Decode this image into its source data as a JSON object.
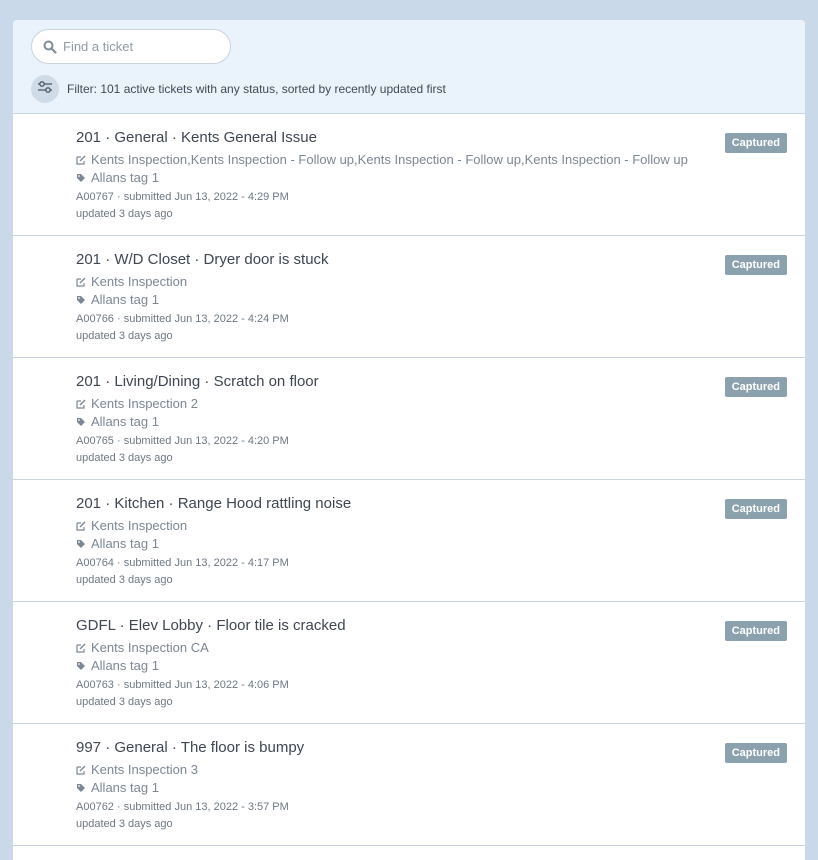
{
  "search": {
    "placeholder": "Find a ticket",
    "icon": "search-icon"
  },
  "filter": {
    "icon": "sliders-icon",
    "text": "Filter: 101 active tickets with any status, sorted by recently updated first"
  },
  "tickets": [
    {
      "title": "201 · General · Kents General Issue",
      "inspection": "Kents Inspection,Kents Inspection - Follow up,Kents Inspection - Follow up,Kents Inspection - Follow up",
      "tag": "Allans tag 1",
      "submitted": "A00767 · submitted Jun 13, 2022 - 4:29 PM",
      "updated": "updated 3 days ago",
      "status": "Captured"
    },
    {
      "title": "201 · W/D Closet · Dryer door is stuck",
      "inspection": "Kents Inspection",
      "tag": "Allans tag 1",
      "submitted": "A00766 · submitted Jun 13, 2022 - 4:24 PM",
      "updated": "updated 3 days ago",
      "status": "Captured"
    },
    {
      "title": "201 · Living/Dining · Scratch on floor",
      "inspection": "Kents Inspection 2",
      "tag": "Allans tag 1",
      "submitted": "A00765 · submitted Jun 13, 2022 - 4:20 PM",
      "updated": "updated 3 days ago",
      "status": "Captured"
    },
    {
      "title": "201 · Kitchen · Range Hood rattling noise",
      "inspection": "Kents Inspection",
      "tag": "Allans tag 1",
      "submitted": "A00764 · submitted Jun 13, 2022 - 4:17 PM",
      "updated": "updated 3 days ago",
      "status": "Captured"
    },
    {
      "title": "GDFL · Elev Lobby · Floor tile is cracked",
      "inspection": "Kents Inspection CA",
      "tag": "Allans tag 1",
      "submitted": "A00763 · submitted Jun 13, 2022 - 4:06 PM",
      "updated": "updated 3 days ago",
      "status": "Captured"
    },
    {
      "title": "997 · General · The floor is bumpy",
      "inspection": "Kents Inspection 3",
      "tag": "Allans tag 1",
      "submitted": "A00762 · submitted Jun 13, 2022 - 3:57 PM",
      "updated": "updated 3 days ago",
      "status": "Captured"
    }
  ],
  "colors": {
    "background": "#c9d9ea",
    "header": "#eaf2fb",
    "badge": "#8ba2ae"
  }
}
